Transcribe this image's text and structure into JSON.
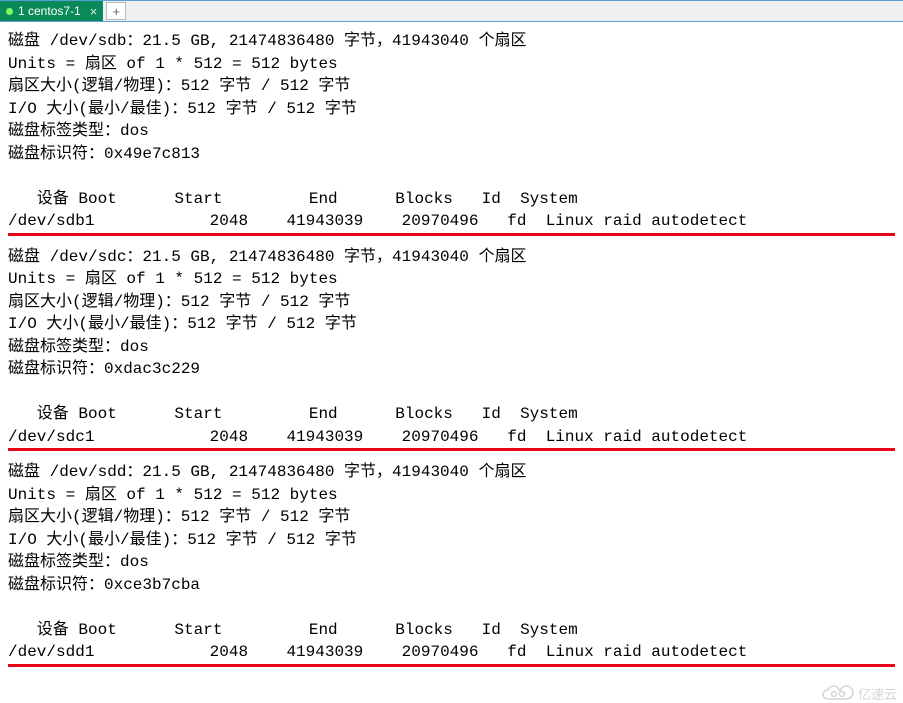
{
  "tabbar": {
    "tab_label": "1 centos7-1",
    "close_glyph": "×",
    "add_glyph": "+"
  },
  "disks": [
    {
      "line_disk": "磁盘 /dev/sdb：21.5 GB, 21474836480 字节，41943040 个扇区",
      "line_units": "Units = 扇区 of 1 * 512 = 512 bytes",
      "line_sect": "扇区大小(逻辑/物理)：512 字节 / 512 字节",
      "line_io": "I/O 大小(最小/最佳)：512 字节 / 512 字节",
      "line_label": "磁盘标签类型：dos",
      "line_id": "磁盘标识符：0x49e7c813",
      "hdr": "   设备 Boot      Start         End      Blocks   Id  System",
      "part": "/dev/sdb1            2048    41943039    20970496   fd  Linux raid autodetect"
    },
    {
      "line_disk": "磁盘 /dev/sdc：21.5 GB, 21474836480 字节，41943040 个扇区",
      "line_units": "Units = 扇区 of 1 * 512 = 512 bytes",
      "line_sect": "扇区大小(逻辑/物理)：512 字节 / 512 字节",
      "line_io": "I/O 大小(最小/最佳)：512 字节 / 512 字节",
      "line_label": "磁盘标签类型：dos",
      "line_id": "磁盘标识符：0xdac3c229",
      "hdr": "   设备 Boot      Start         End      Blocks   Id  System",
      "part": "/dev/sdc1            2048    41943039    20970496   fd  Linux raid autodetect"
    },
    {
      "line_disk": "磁盘 /dev/sdd：21.5 GB, 21474836480 字节，41943040 个扇区",
      "line_units": "Units = 扇区 of 1 * 512 = 512 bytes",
      "line_sect": "扇区大小(逻辑/物理)：512 字节 / 512 字节",
      "line_io": "I/O 大小(最小/最佳)：512 字节 / 512 字节",
      "line_label": "磁盘标签类型：dos",
      "line_id": "磁盘标识符：0xce3b7cba",
      "hdr": "   设备 Boot      Start         End      Blocks   Id  System",
      "part": "/dev/sdd1            2048    41943039    20970496   fd  Linux raid autodetect"
    }
  ],
  "watermark": {
    "text": "亿速云"
  }
}
